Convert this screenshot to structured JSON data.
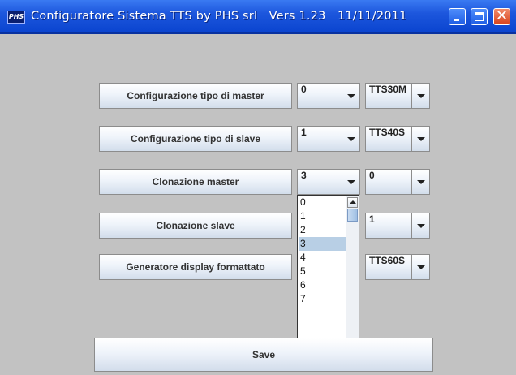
{
  "window": {
    "icon_text": "PHS",
    "title": "Configuratore Sistema TTS by PHS srl   Vers 1.23   11/11/2011"
  },
  "rows": [
    {
      "button": "Configurazione tipo di master",
      "combo1": "0",
      "combo2": "TTS30M"
    },
    {
      "button": "Configurazione tipo di slave",
      "combo1": "1",
      "combo2": "TTS40S"
    },
    {
      "button": "Clonazione master",
      "combo1": "3",
      "combo2": "0"
    },
    {
      "button": "Clonazione slave",
      "combo2": "1"
    },
    {
      "button": "Generatore display formattato",
      "combo2": "TTS60S"
    }
  ],
  "dropdown": {
    "options": [
      "0",
      "1",
      "2",
      "3",
      "4",
      "5",
      "6",
      "7"
    ],
    "selected": "3"
  },
  "save_label": "Save"
}
